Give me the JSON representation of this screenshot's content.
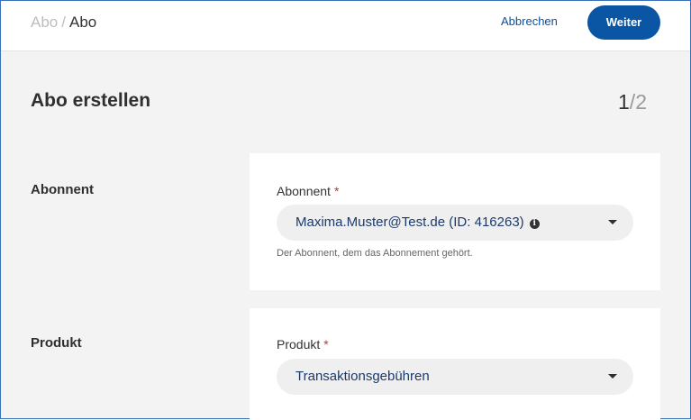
{
  "header": {
    "breadcrumb": {
      "parent": "Abo",
      "separator": "/",
      "current": "Abo"
    },
    "cancel_label": "Abbrechen",
    "next_label": "Weiter"
  },
  "page": {
    "title": "Abo erstellen",
    "step": {
      "current": "1",
      "separator": "/",
      "total": "2"
    }
  },
  "sections": {
    "subscriber": {
      "label": "Abonnent",
      "field_label": "Abonnent",
      "required_mark": "*",
      "value": "Maxima.Muster@Test.de (ID: 416263)",
      "info_icon": "i",
      "help": "Der Abonnent, dem das Abonnement gehört."
    },
    "product": {
      "label": "Produkt",
      "field_label": "Produkt",
      "required_mark": "*",
      "value": "Transaktionsgebühren"
    }
  },
  "colors": {
    "primary": "#0b56a4",
    "link": "#0b4f9c",
    "required": "#c0392b"
  }
}
